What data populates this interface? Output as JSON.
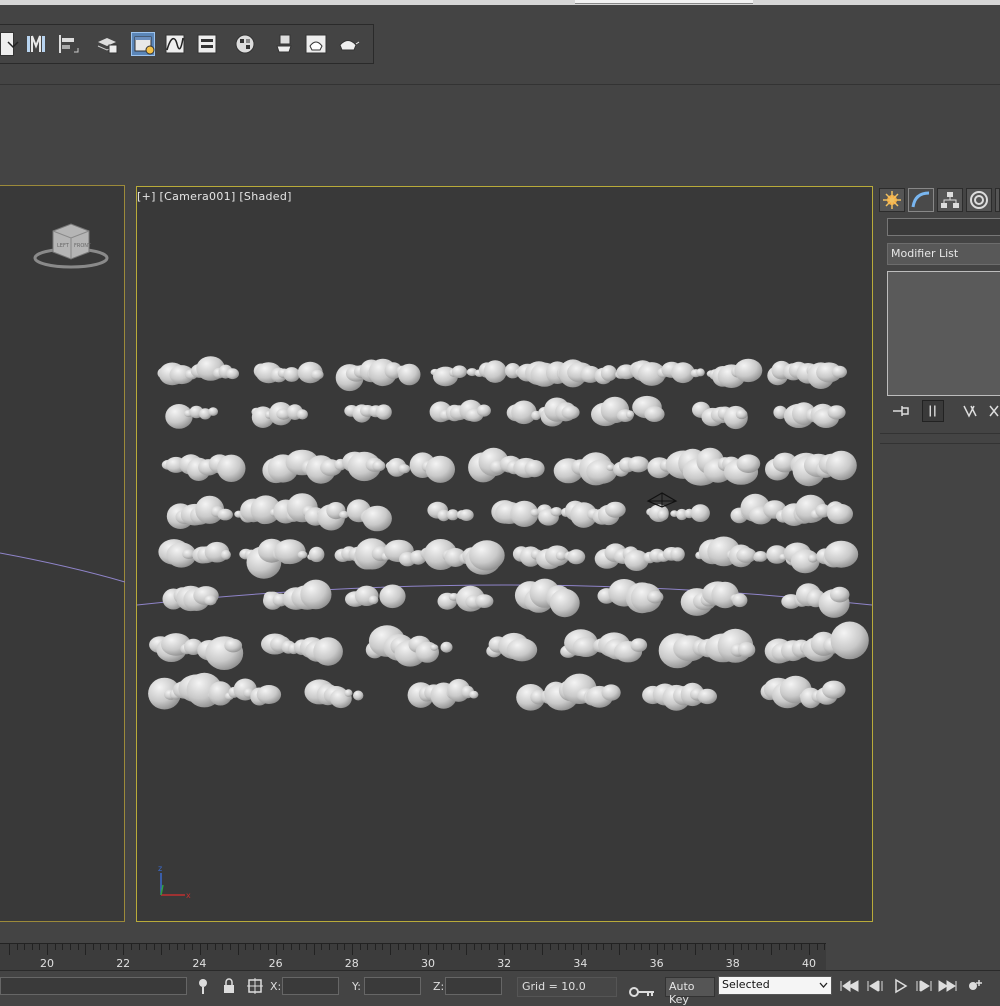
{
  "viewport": {
    "label": "[+] [Camera001] [Shaded]"
  },
  "command_panel": {
    "modifier_list_label": "Modifier List"
  },
  "timeline": {
    "ticks": [
      "20",
      "22",
      "24",
      "26",
      "28",
      "30",
      "32",
      "34",
      "36",
      "38",
      "40"
    ]
  },
  "statusbar": {
    "x_label": "X:",
    "y_label": "Y:",
    "z_label": "Z:",
    "grid_label": "Grid = 10.0",
    "autokey_label": "Auto Key",
    "selection_mode": "Selected"
  },
  "icons": {
    "toolbar": [
      "dropdown-arrow-icon",
      "mirror-icon",
      "align-icon",
      "layer-manager-icon",
      "scene-explorer-icon",
      "curve-editor-icon",
      "schematic-view-icon",
      "material-editor-icon",
      "render-setup-icon",
      "rendered-frame-icon",
      "render-icon"
    ],
    "command_tabs": [
      "create-icon",
      "modify-icon",
      "hierarchy-icon",
      "motion-icon"
    ],
    "stack_tools": [
      "pin-stack-icon",
      "show-end-result-icon",
      "make-unique-icon",
      "remove-modifier-icon"
    ],
    "playback": [
      "go-to-start-icon",
      "previous-frame-icon",
      "play-icon",
      "next-frame-icon",
      "go-to-end-icon"
    ]
  },
  "colors": {
    "active_viewport_border": "#b9ab3a",
    "viewport_bg": "#393939",
    "active_button": "#5b86b8",
    "horizon_line": "#8f84c9"
  }
}
